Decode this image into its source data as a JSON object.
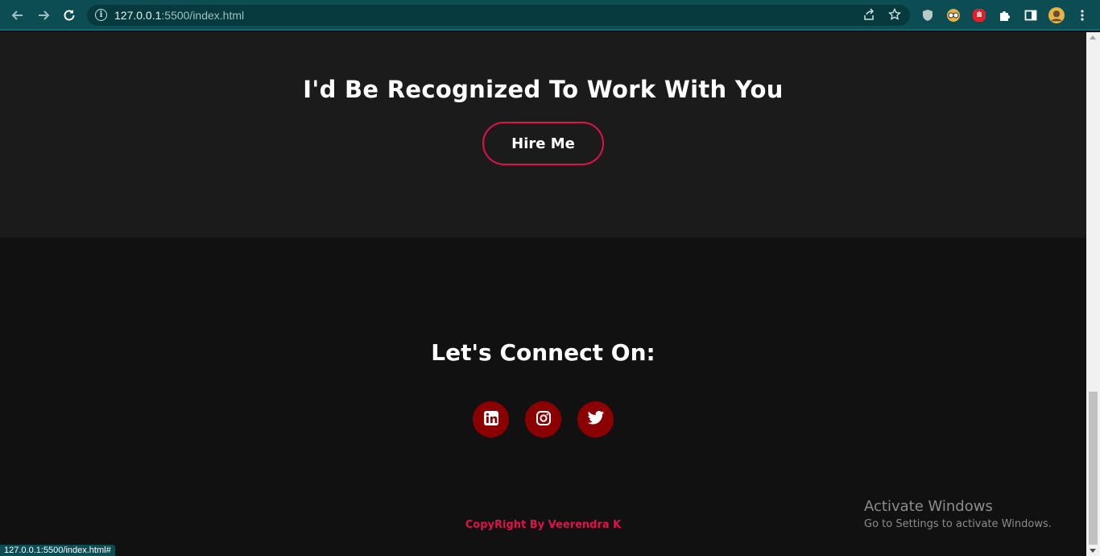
{
  "browser": {
    "url_host": "127.0.0.1",
    "url_rest": ":5500/index.html"
  },
  "hire": {
    "title": "I'd Be Recognized To Work With You",
    "button_label": "Hire Me"
  },
  "footer": {
    "connect_title": "Let's Connect On:",
    "social": [
      {
        "name": "linkedin-icon"
      },
      {
        "name": "instagram-icon"
      },
      {
        "name": "twitter-icon"
      }
    ],
    "copyright": "CopyRight By Veerendra K"
  },
  "watermark": {
    "title": "Activate Windows",
    "subtitle": "Go to Settings to activate Windows."
  },
  "status_bar": {
    "text": "127.0.0.1:5500/index.html#"
  },
  "colors": {
    "accent": "#e0114a",
    "social_bg": "#8b0000",
    "section_bg": "#1b1b1b",
    "footer_bg": "#111111",
    "chrome_bg": "#0b4d53"
  }
}
